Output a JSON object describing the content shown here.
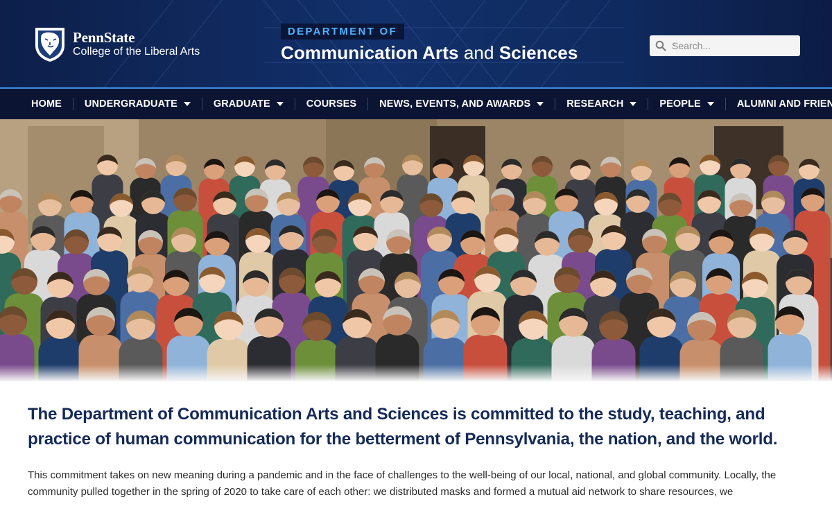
{
  "header": {
    "brand_name": "PennState",
    "college": "College of the Liberal Arts",
    "dept_tag": "DEPARTMENT OF",
    "dept_strong_1": "Communication Arts",
    "dept_light": " and ",
    "dept_strong_2": "Sciences",
    "search_placeholder": "Search..."
  },
  "nav": {
    "items": [
      {
        "label": "HOME",
        "dropdown": false
      },
      {
        "label": "UNDERGRADUATE",
        "dropdown": true
      },
      {
        "label": "GRADUATE",
        "dropdown": true
      },
      {
        "label": "COURSES",
        "dropdown": false
      },
      {
        "label": "NEWS, EVENTS, AND AWARDS",
        "dropdown": true
      },
      {
        "label": "RESEARCH",
        "dropdown": true
      },
      {
        "label": "PEOPLE",
        "dropdown": true
      },
      {
        "label": "ALUMNI AND FRIENDS",
        "dropdown": false
      }
    ]
  },
  "main": {
    "mission": "The Department of Communication Arts and Sciences is committed to the study, teaching, and practice of human communication for the betterment of Pennsylvania, the nation, and the world.",
    "body": "This commitment takes on new meaning during a pandemic and in the face of challenges to the well-being of our local, national, and global community. Locally, the community pulled together in the spring of 2020 to take care of each other: we distributed masks and formed a mutual aid network to share resources, we"
  },
  "colors": {
    "header_bg": "#12306b",
    "nav_bg": "#0b1533",
    "accent_blue": "#3a8ee6",
    "dept_tag_text": "#4fb3ff",
    "mission_text": "#152a58"
  },
  "icons": {
    "logo": "nittany-lion-shield-icon",
    "search": "search-icon",
    "dropdown": "caret-down-icon"
  }
}
